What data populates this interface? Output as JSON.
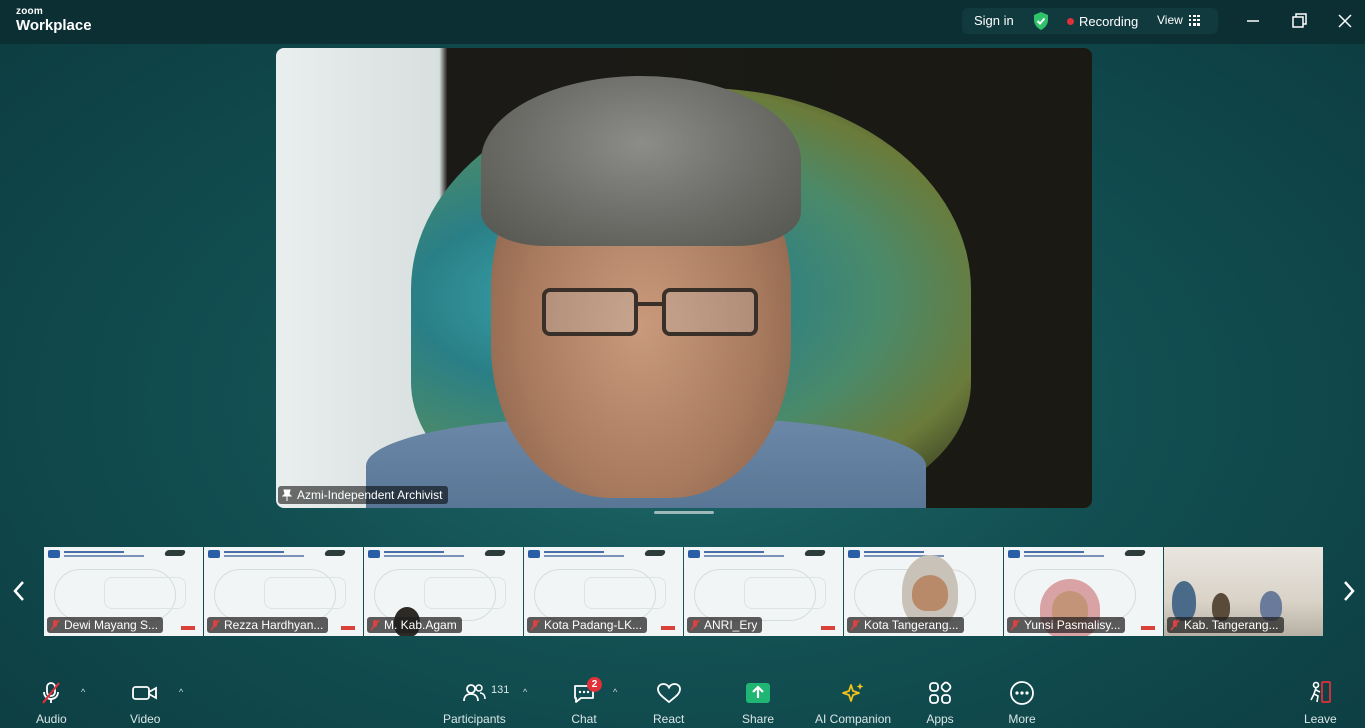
{
  "app": {
    "brand_small": "zoom",
    "brand_large": "Workplace"
  },
  "titlebar": {
    "sign_in": "Sign in",
    "recording": "Recording",
    "view": "View"
  },
  "main_video": {
    "name": "Azmi-Independent Archivist"
  },
  "thumbnails": [
    {
      "name": "Dewi Mayang S..."
    },
    {
      "name": "Rezza Hardhyan..."
    },
    {
      "name": "M. Kab.Agam"
    },
    {
      "name": "Kota Padang-LK..."
    },
    {
      "name": "ANRI_Ery"
    },
    {
      "name": "Kota Tangerang..."
    },
    {
      "name": "Yunsi Pasmalisy..."
    },
    {
      "name": "Kab. Tangerang..."
    }
  ],
  "toolbar": {
    "audio": "Audio",
    "video": "Video",
    "participants": "Participants",
    "participants_count": "131",
    "chat": "Chat",
    "chat_badge": "2",
    "react": "React",
    "share": "Share",
    "ai_companion": "AI Companion",
    "apps": "Apps",
    "more": "More",
    "leave": "Leave"
  },
  "colors": {
    "background": "#124f52",
    "titlebar": "#0c2f33",
    "recording": "#e0303a",
    "share": "#1fb573",
    "shield": "#2fc26b",
    "ai": "#f0c419"
  },
  "icons": [
    "shield-icon",
    "grid-icon",
    "minimize-icon",
    "restore-icon",
    "close-icon",
    "pin-icon",
    "mic-off-icon",
    "video-icon",
    "participants-icon",
    "chat-icon",
    "heart-icon",
    "share-icon",
    "sparkle-icon",
    "apps-icon",
    "more-icon",
    "leave-icon",
    "chevron-left-icon",
    "chevron-right-icon"
  ]
}
